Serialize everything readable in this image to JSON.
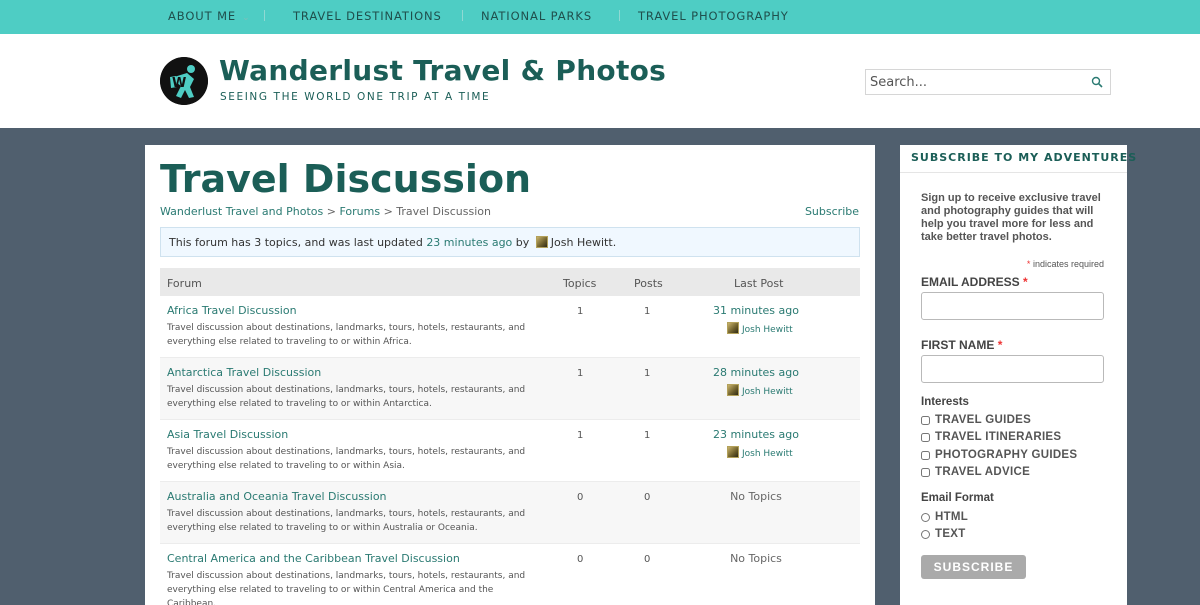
{
  "topnav": {
    "items": [
      {
        "label": "About Me",
        "has_dropdown": true
      },
      {
        "label": "Travel Destinations"
      },
      {
        "label": "National Parks"
      },
      {
        "label": "Travel Photography"
      }
    ],
    "caret": "⌄"
  },
  "header": {
    "logo_letter": "W",
    "site_title": "Wanderlust Travel & Photos",
    "tagline": "SEEING THE WORLD ONE TRIP AT A TIME",
    "search_placeholder": "Search..."
  },
  "main": {
    "page_title": "Travel Discussion",
    "breadcrumb": [
      {
        "label": "Wanderlust Travel and Photos"
      },
      {
        "label": "Forums"
      },
      {
        "label": "Travel Discussion"
      }
    ],
    "breadcrumb_sep": ">",
    "subscribe_label": "Subscribe",
    "notice": {
      "prefix": "This forum has 3 topics, and was last updated",
      "updated": "23 minutes ago",
      "by": "by",
      "author": "Josh Hewitt",
      "suffix": "."
    },
    "table": {
      "headers": {
        "forum": "Forum",
        "topics": "Topics",
        "posts": "Posts",
        "last_post": "Last Post"
      },
      "rows": [
        {
          "title": "Africa Travel Discussion",
          "desc": "Travel discussion about destinations, landmarks, tours, hotels, restaurants, and everything else related to traveling to or within Africa.",
          "topics": "1",
          "posts": "1",
          "last": "31 minutes ago",
          "author": "Josh Hewitt"
        },
        {
          "title": "Antarctica Travel Discussion",
          "desc": "Travel discussion about destinations, landmarks, tours, hotels, restaurants, and everything else related to traveling to or within Antarctica.",
          "topics": "1",
          "posts": "1",
          "last": "28 minutes ago",
          "author": "Josh Hewitt"
        },
        {
          "title": "Asia Travel Discussion",
          "desc": "Travel discussion about destinations, landmarks, tours, hotels, restaurants, and everything else related to traveling to or within Asia.",
          "topics": "1",
          "posts": "1",
          "last": "23 minutes ago",
          "author": "Josh Hewitt"
        },
        {
          "title": "Australia and Oceania Travel Discussion",
          "desc": "Travel discussion about destinations, landmarks, tours, hotels, restaurants, and everything else related to traveling to or within Australia or Oceania.",
          "topics": "0",
          "posts": "0",
          "last": "No Topics",
          "author": ""
        },
        {
          "title": "Central America and the Caribbean Travel Discussion",
          "desc": "Travel discussion about destinations, landmarks, tours, hotels, restaurants, and everything else related to traveling to or within Central America and the Caribbean.",
          "topics": "0",
          "posts": "0",
          "last": "No Topics",
          "author": ""
        }
      ]
    }
  },
  "sidebar": {
    "title": "SUBSCRIBE TO MY ADVENTURES",
    "intro": "Sign up to receive exclusive travel and photography guides that will help you travel more for less and take better travel photos.",
    "required_note": "indicates required",
    "asterisk": "*",
    "email_label": "EMAIL ADDRESS",
    "firstname_label": "FIRST NAME",
    "interests_label": "Interests",
    "interests": [
      "TRAVEL GUIDES",
      "TRAVEL ITINERARIES",
      "PHOTOGRAPHY GUIDES",
      "TRAVEL ADVICE"
    ],
    "format_label": "Email Format",
    "formats": [
      "HTML",
      "TEXT"
    ],
    "subscribe_button": "SUBSCRIBE"
  },
  "colors": {
    "nav_bg": "#4ecdc4",
    "brand": "#1b5e57",
    "link": "#2a7a72",
    "page_bg": "#505f6e"
  }
}
